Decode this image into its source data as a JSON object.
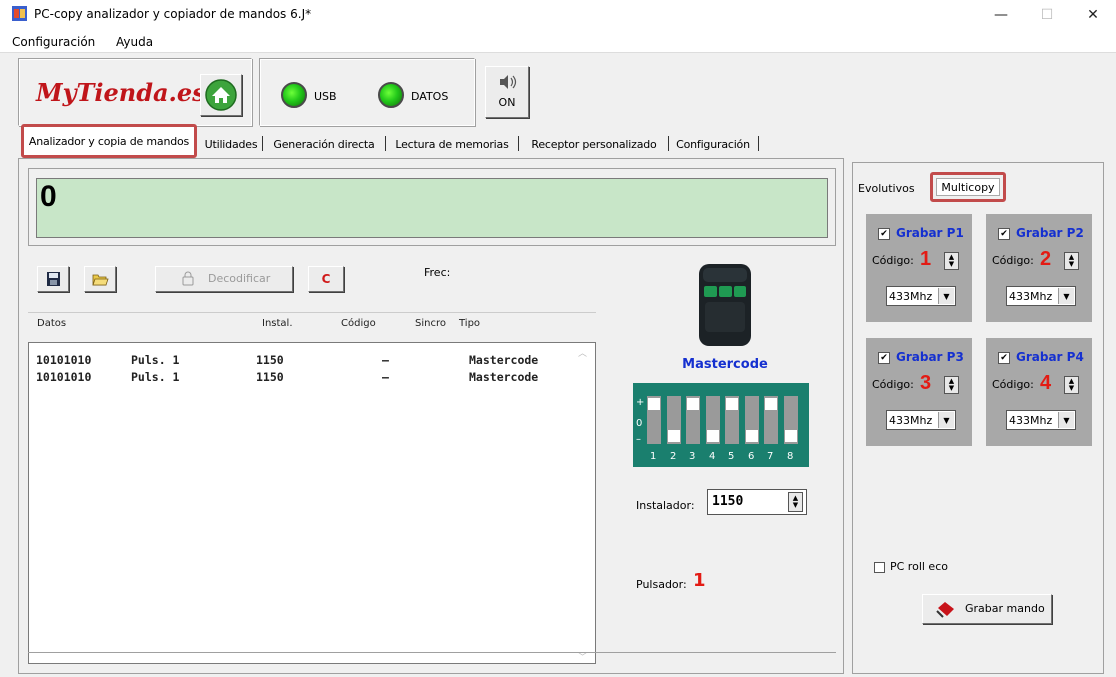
{
  "window": {
    "title": "PC-copy analizador y copiador de mandos 6.J*",
    "minimize_glyph": "—",
    "maximize_glyph": "☐",
    "close_glyph": "✕"
  },
  "menu": [
    {
      "label": "Configuración"
    },
    {
      "label": "Ayuda"
    }
  ],
  "header": {
    "logo_text": "MyTienda.es",
    "usb_label": "USB",
    "datos_label": "DATOS",
    "sound_label": "ON",
    "led_color": "#23c91a",
    "logo_color": "#c0151a"
  },
  "tabs": [
    {
      "label": "Analizador y copia de mandos",
      "active": true
    },
    {
      "label": "Utilidades"
    },
    {
      "label": "Generación directa"
    },
    {
      "label": "Lectura de memorias"
    },
    {
      "label": "Receptor personalizado"
    },
    {
      "label": "Configuración"
    }
  ],
  "display": {
    "value": "0",
    "bg_color": "#c8e6c8"
  },
  "toolbar": {
    "decodificar_label": "Decodificar",
    "clear_label": "C",
    "frec_label": "Frec:"
  },
  "table": {
    "columns": [
      "Datos",
      "Instal.",
      "Código",
      "Sincro",
      "Tipo"
    ],
    "rows": [
      {
        "datos": "10101010",
        "puls": "Puls. 1",
        "instal": "1150",
        "codigo": "–",
        "tipo": "Mastercode"
      },
      {
        "datos": "10101010",
        "puls": "Puls. 1",
        "instal": "1150",
        "codigo": "–",
        "tipo": "Mastercode"
      }
    ]
  },
  "remote": {
    "name": "Mastercode",
    "dip_plus": "+",
    "dip_zero": "0",
    "dip_minus": "–",
    "dip_numbers": [
      "1",
      "2",
      "3",
      "4",
      "5",
      "6",
      "7",
      "8"
    ],
    "dip_states": [
      "+",
      "-",
      "+",
      "-",
      "+",
      "-",
      "+",
      "-"
    ],
    "instalador_label": "Instalador:",
    "instalador_value": "1150",
    "pulsador_label": "Pulsador:",
    "pulsador_value": "1"
  },
  "right_panel": {
    "tabs": [
      {
        "label": "Evolutivos"
      },
      {
        "label": "Multicopy",
        "active": true
      }
    ],
    "slots": [
      {
        "label": "Grabar P1",
        "checked": true,
        "codigo_label": "Código:",
        "codigo": "1",
        "freq": "433Mhz"
      },
      {
        "label": "Grabar P2",
        "checked": true,
        "codigo_label": "Código:",
        "codigo": "2",
        "freq": "433Mhz"
      },
      {
        "label": "Grabar P3",
        "checked": true,
        "codigo_label": "Código:",
        "codigo": "3",
        "freq": "433Mhz"
      },
      {
        "label": "Grabar P4",
        "checked": true,
        "codigo_label": "Código:",
        "codigo": "4",
        "freq": "433Mhz"
      }
    ],
    "pc_roll_eco_label": "PC roll eco",
    "pc_roll_eco_checked": false,
    "grabar_mando_label": "Grabar mando"
  },
  "colors": {
    "highlight_frame": "#c24b4b",
    "accent_blue": "#1530d0",
    "accent_red": "#e31b14"
  }
}
